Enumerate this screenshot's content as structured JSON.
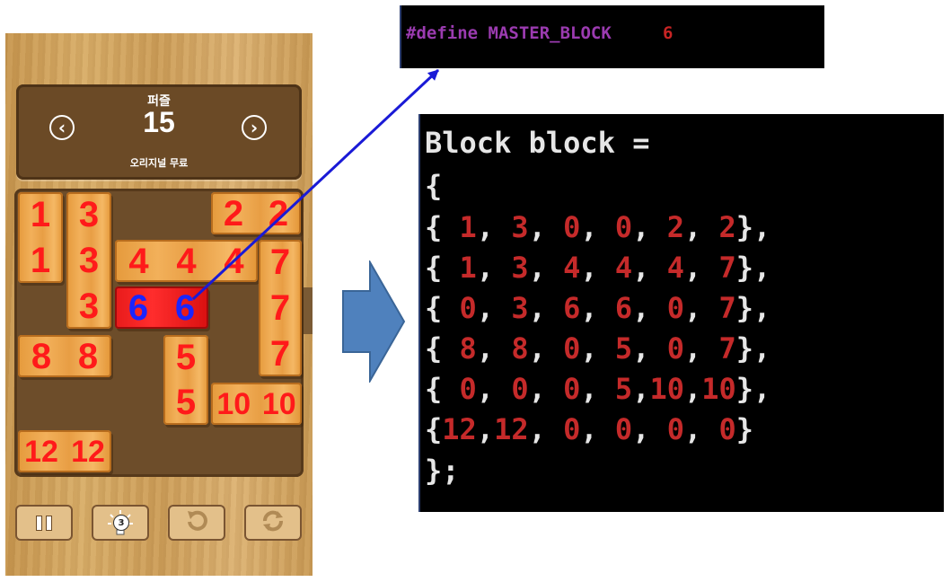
{
  "game": {
    "mode_label": "퍼즐",
    "level_number": "15",
    "pack_label": "오리지널 무료",
    "hint_count": "3",
    "blocks": [
      {
        "id": "1",
        "labels": [
          "1",
          "1"
        ]
      },
      {
        "id": "3",
        "labels": [
          "3",
          "3",
          "3"
        ]
      },
      {
        "id": "2",
        "labels": [
          "2",
          "2"
        ]
      },
      {
        "id": "4",
        "labels": [
          "4",
          "4",
          "4"
        ]
      },
      {
        "id": "7",
        "labels": [
          "7",
          "7",
          "7"
        ]
      },
      {
        "id": "6",
        "labels": [
          "6",
          "6"
        ]
      },
      {
        "id": "8",
        "labels": [
          "8",
          "8"
        ]
      },
      {
        "id": "5",
        "labels": [
          "5",
          "5"
        ]
      },
      {
        "id": "10",
        "labels": [
          "10",
          "10"
        ]
      },
      {
        "id": "12",
        "labels": [
          "12",
          "12"
        ]
      }
    ]
  },
  "define": {
    "keyword": "#define MASTER_BLOCK",
    "value": "6"
  },
  "code": {
    "header": "Block block =",
    "open_brace": "{",
    "close": "};",
    "rows": [
      [
        "1",
        "3",
        "0",
        "0",
        "2",
        "2"
      ],
      [
        "1",
        "3",
        "4",
        "4",
        "4",
        "7"
      ],
      [
        "0",
        "3",
        "6",
        "6",
        "0",
        "7"
      ],
      [
        "8",
        "8",
        "0",
        "5",
        "0",
        "7"
      ],
      [
        "0",
        "0",
        "0",
        "5",
        "10",
        "10"
      ],
      [
        "12",
        "12",
        "0",
        "0",
        "0",
        "0"
      ]
    ]
  },
  "colors": {
    "board": "#6d4d2a",
    "block": "#f2b05a",
    "master_block": "#ff2d2d",
    "label_red": "#ff1a1a",
    "label_blue": "#1a25ff",
    "arrow_blue": "#4f81bd",
    "pointer_line": "#1a1ad6",
    "console_value_red": "#c52a2a",
    "define_purple": "#9b3bb0"
  }
}
